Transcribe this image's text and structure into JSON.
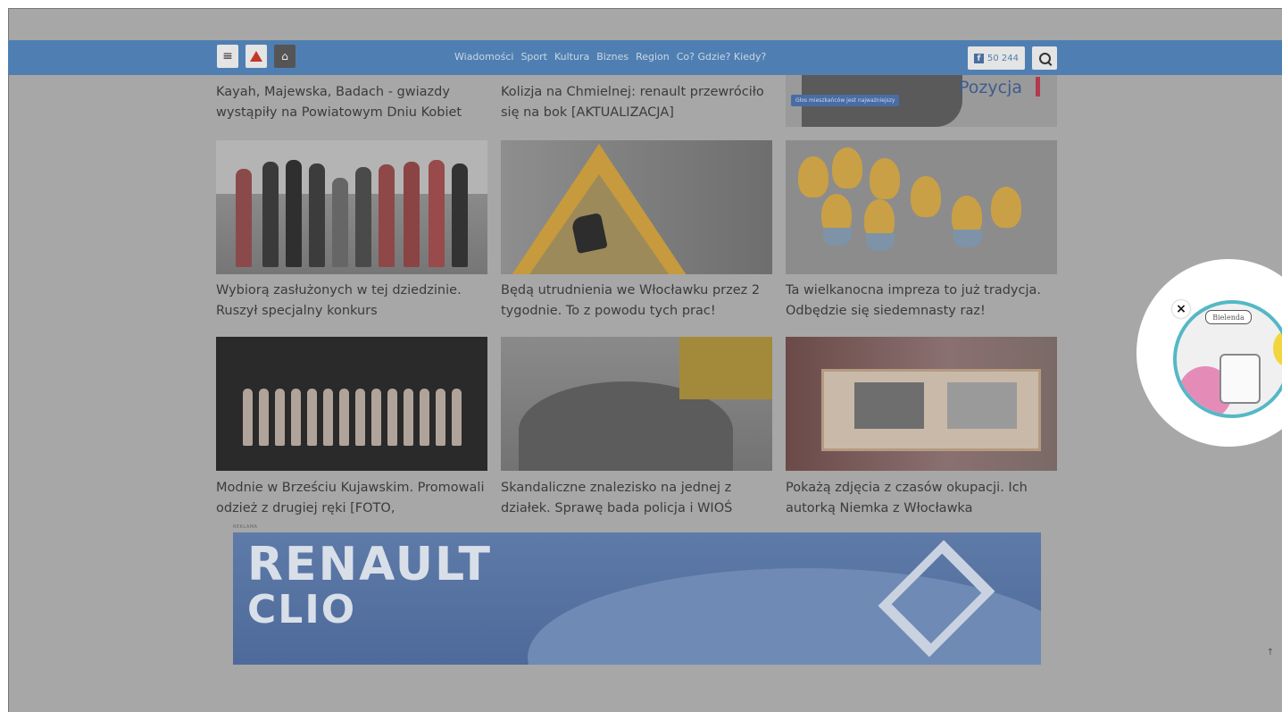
{
  "nav": {
    "menu_icon": "hamburger-icon",
    "alert_icon": "warning-icon",
    "home_icon": "home-icon",
    "links": [
      "Wiadomości",
      "Sport",
      "Kultura",
      "Biznes",
      "Region",
      "Co? Gdzie? Kiedy?"
    ],
    "facebook_count": "50 244",
    "facebook_icon": "facebook-icon",
    "search_icon": "search-icon"
  },
  "top_row": {
    "item1": "Kayah, Majewska, Badach - gwiazdy wystąpiły na Powiatowym Dniu Kobiet",
    "item2": "Kolizja na Chmielnej: renault przewróciło się na bok [AKTUALIZACJA]",
    "promo_badge": "Głos mieszkańców jest najważniejszy",
    "promo_word": "Pozycja"
  },
  "articles": [
    {
      "title": "Wybiorą zasłużonych w tej dziedzinie. Ruszył specjalny konkurs"
    },
    {
      "title": "Będą utrudnienia we Włocławku przez 2 tygodnie. To z powodu tych prac!"
    },
    {
      "title": "Ta wielkanocna impreza to już tradycja. Odbędzie się siedemnasty raz!"
    },
    {
      "title": "Modnie w Brześciu Kujawskim. Promowali odzież z drugiej ręki [FOTO,"
    },
    {
      "title": "Skandaliczne znalezisko na jednej z działek. Sprawę bada policja i WIOŚ"
    },
    {
      "title": "Pokażą zdjęcia z czasów okupacji. Ich autorką Niemka z Włocławka"
    }
  ],
  "ad": {
    "label": "REKLAMA",
    "line1": "RENAULT",
    "line2": "CLIO"
  },
  "floating_ad": {
    "close": "×",
    "brand": "Bielenda"
  },
  "scroll_top": "↑",
  "colors": {
    "overlay": "#a7a7a7",
    "nav": "#4f7fb2",
    "accent_red": "#c0392b"
  }
}
